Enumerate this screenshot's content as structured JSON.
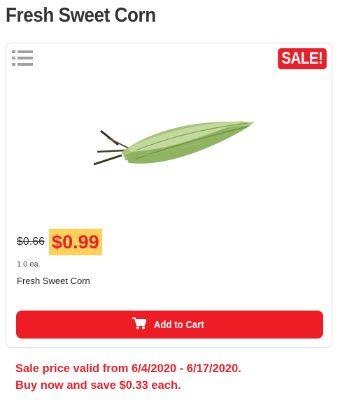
{
  "product": {
    "title": "Fresh Sweet Corn",
    "name": "Fresh Sweet Corn",
    "unit": "1.0 ea.",
    "sale_badge": "SALE!",
    "old_price": "$0.66",
    "sale_price": "$0.99",
    "image_icon": "corn-image"
  },
  "actions": {
    "add_to_cart_label": "Add to Cart",
    "cart_icon": "cart-icon",
    "list_icon": "list-icon"
  },
  "notice": {
    "line1": "Sale price valid from 6/4/2020 - 6/17/2020.",
    "line2": "Buy now and save $0.33 each."
  },
  "colors": {
    "accent_red": "#ee1c25",
    "price_highlight": "#ffd159",
    "badge_red": "#e8202a"
  }
}
